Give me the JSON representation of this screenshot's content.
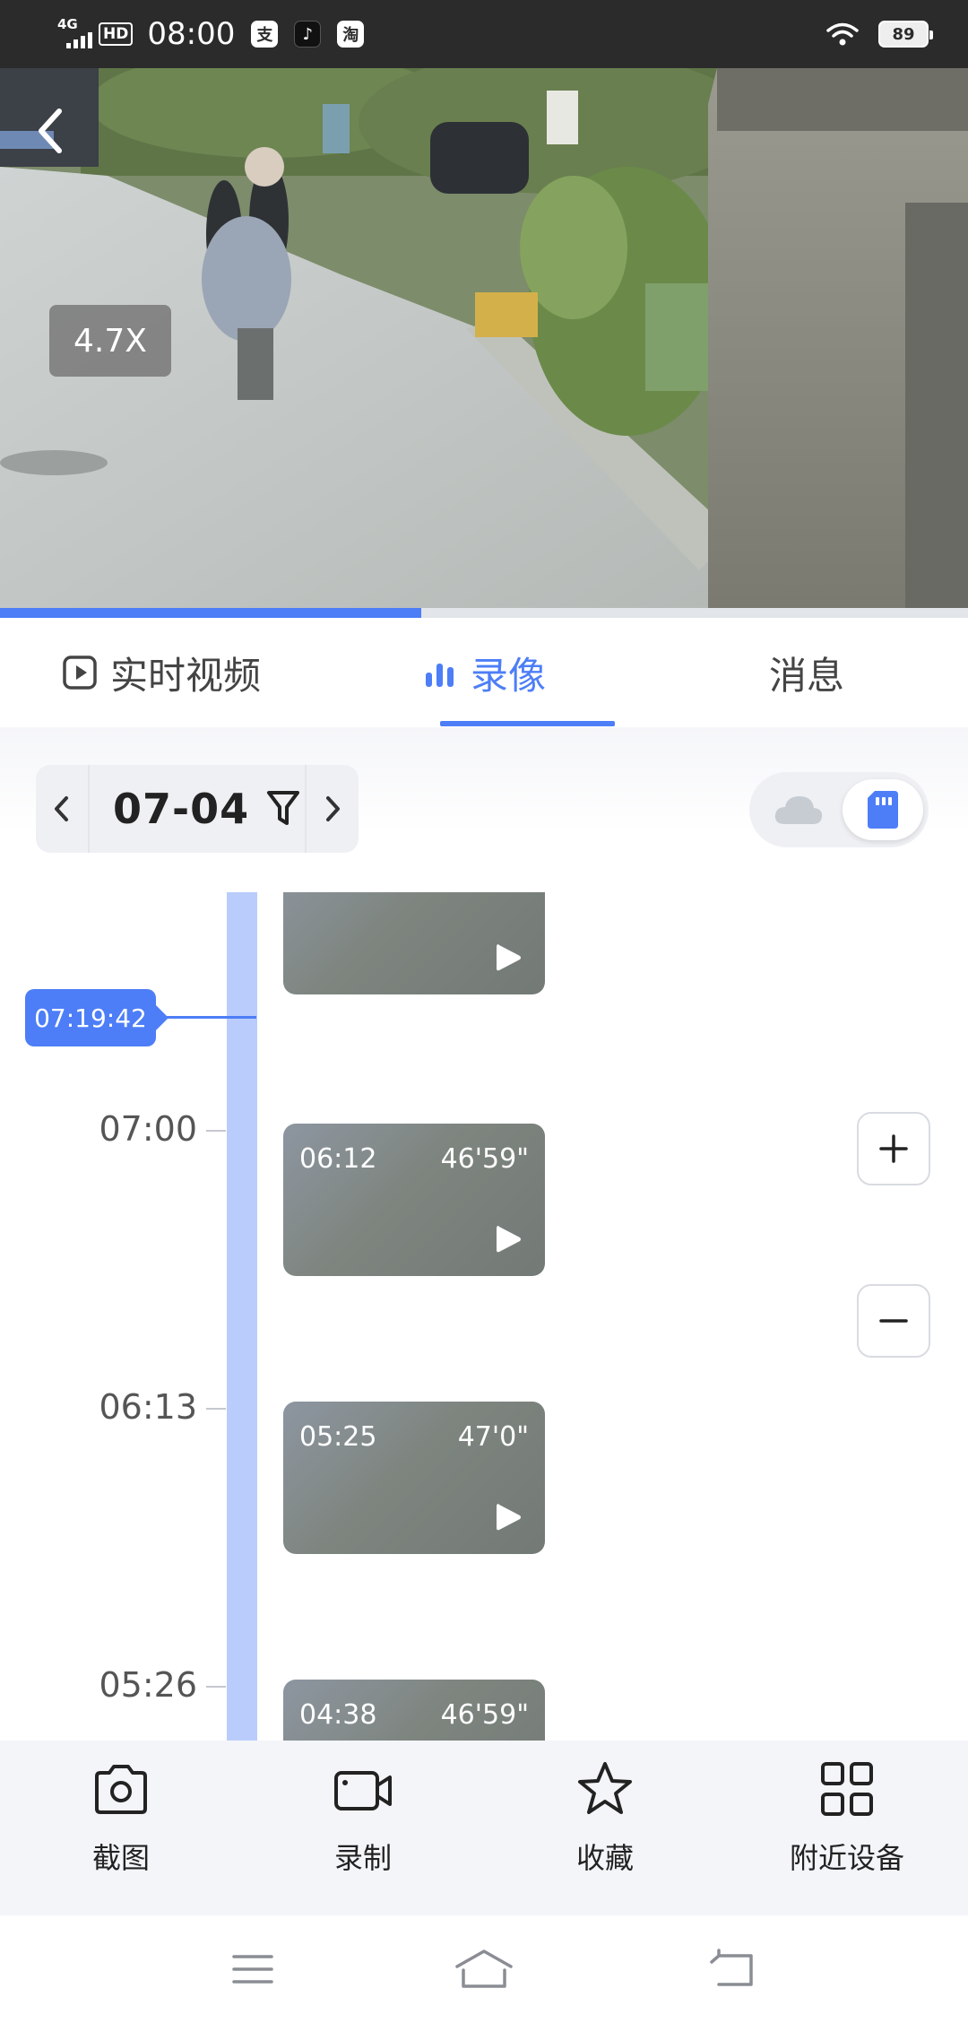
{
  "status_bar": {
    "network": "4G",
    "hd": "HD",
    "time": "08:00",
    "app_icons": [
      "支",
      "♪",
      "淘"
    ],
    "battery": "89"
  },
  "video": {
    "zoom_level": "4.7X",
    "playback_progress": 0.435
  },
  "tabs": [
    {
      "label": "实时视频",
      "icon": "play-square-icon",
      "active": false
    },
    {
      "label": "录像",
      "icon": "bar-chart-icon",
      "active": true
    },
    {
      "label": "消息",
      "active": false
    }
  ],
  "date_picker": {
    "date": "07-04"
  },
  "storage_source": {
    "options": [
      "cloud",
      "sd-card"
    ],
    "selected": "sd-card"
  },
  "timeline": {
    "cursor_time": "07:19:42",
    "hour_labels": [
      "07:00",
      "06:13",
      "05:26"
    ],
    "clips": [
      {
        "start": "06:12",
        "duration": "46'59\""
      },
      {
        "start": "05:25",
        "duration": "47'0\""
      },
      {
        "start": "04:38",
        "duration": "46'59\""
      }
    ]
  },
  "zoom_controls": {
    "plus": "+",
    "minus": "−"
  },
  "actions": [
    {
      "label": "截图",
      "icon": "camera-icon"
    },
    {
      "label": "录制",
      "icon": "video-record-icon"
    },
    {
      "label": "收藏",
      "icon": "star-icon"
    },
    {
      "label": "附近设备",
      "icon": "grid-icon"
    }
  ],
  "colors": {
    "accent": "#4d7ef7",
    "timeline_bar": "#b9ccfb",
    "status_bar_bg": "#2b2b2b"
  }
}
